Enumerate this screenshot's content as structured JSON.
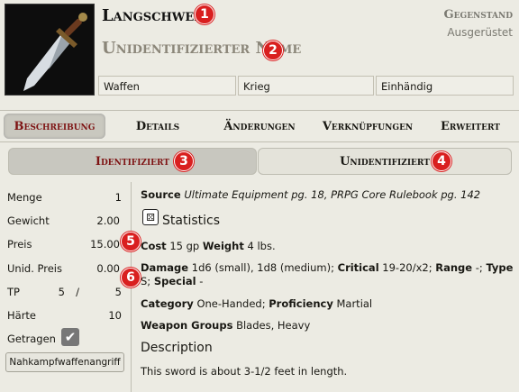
{
  "header": {
    "name": "Langschwert",
    "unidentified_name": "Unidentifizierter Name",
    "type": "Gegenstand",
    "status": "Ausgerüstet",
    "tags": [
      "Waffen",
      "Krieg",
      "Einhändig"
    ]
  },
  "badges": [
    "1",
    "2",
    "3",
    "4",
    "5",
    "6"
  ],
  "tabs": [
    "Beschreibung",
    "Details",
    "Änderungen",
    "Verknüpfungen",
    "Erweitert"
  ],
  "subtabs": [
    "Identifiziert",
    "Unidentifiziert"
  ],
  "sidebar": {
    "stats": [
      {
        "label": "Menge",
        "value": "1"
      },
      {
        "label": "Gewicht",
        "value": "2.00"
      },
      {
        "label": "Preis",
        "value": "15.00"
      },
      {
        "label": "Unid. Preis",
        "value": "0.00"
      }
    ],
    "hp_label": "TP",
    "hp_current": "5",
    "hp_sep": "/",
    "hp_max": "5",
    "hardness_label": "Härte",
    "hardness_value": "10",
    "equipped_label": "Getragen",
    "attack_button": "Nahkampfwaffenangriff"
  },
  "description": {
    "source_label": "Source",
    "source_text": "Ultimate Equipment pg. 18, PRPG Core Rulebook pg. 142",
    "statistics_heading": "Statistics",
    "cost_label": "Cost",
    "cost_value": "15 gp",
    "weight_label": "Weight",
    "weight_value": "4 lbs.",
    "damage_label": "Damage",
    "damage_value": "1d6 (small), 1d8 (medium);",
    "critical_label": "Critical",
    "critical_value": "19-20/x2;",
    "range_label": "Range",
    "range_value": "-;",
    "type_label": "Type",
    "type_value": "S;",
    "special_label": "Special",
    "special_value": "-",
    "category_label": "Category",
    "category_value": "One-Handed;",
    "proficiency_label": "Proficiency",
    "proficiency_value": "Martial",
    "groups_label": "Weapon Groups",
    "groups_value": "Blades, Heavy",
    "description_heading": "Description",
    "description_text": "This sword is about 3-1/2 feet in length."
  },
  "colors": {
    "active_tab": "#7e1414",
    "badge": "#d91f1f"
  },
  "icons": {
    "stats": "statistics-icon",
    "check": "check-icon",
    "sword": "sword-image"
  }
}
